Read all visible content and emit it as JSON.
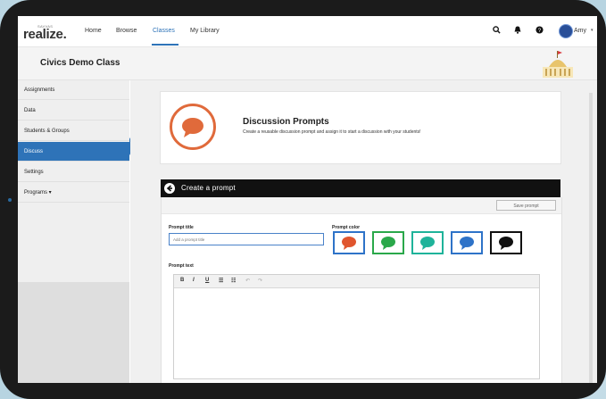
{
  "app": {
    "logo_small": "SAVVAS",
    "logo_text": "realize."
  },
  "nav": {
    "items": [
      "Home",
      "Browse",
      "Classes",
      "My Library"
    ],
    "active": "Classes"
  },
  "header": {
    "user_name": "Amy",
    "icons": [
      "search-icon",
      "bell-icon",
      "help-icon",
      "avatar",
      "chevron-down-icon"
    ]
  },
  "class": {
    "title": "Civics Demo Class"
  },
  "sidebar": {
    "items": [
      {
        "label": "Assignments"
      },
      {
        "label": "Data"
      },
      {
        "label": "Students & Groups"
      },
      {
        "label": "Discuss"
      },
      {
        "label": "Settings"
      },
      {
        "label": "Programs ▾"
      }
    ],
    "active_index": 3
  },
  "discussion": {
    "title": "Discussion Prompts",
    "subtitle": "Create a reusable discussion prompt and assign it to start a discussion with your students!"
  },
  "create": {
    "label": "Create a prompt",
    "save_label": "Save prompt"
  },
  "form": {
    "prompt_title_label": "Prompt title",
    "prompt_title_placeholder": "Add a prompt title",
    "prompt_color_label": "Prompt color",
    "prompt_text_label": "Prompt text",
    "colors": [
      "#e0552e",
      "#2aa84a",
      "#1fb39a",
      "#2e73c8",
      "#111111"
    ],
    "selected_color_index": 0
  },
  "editor": {
    "tools": [
      "B",
      "I",
      "U",
      "☰",
      "☷",
      "↶",
      "↷"
    ]
  },
  "colors": {
    "accent": "#2e73b8",
    "bubble": "#e06a3b"
  }
}
